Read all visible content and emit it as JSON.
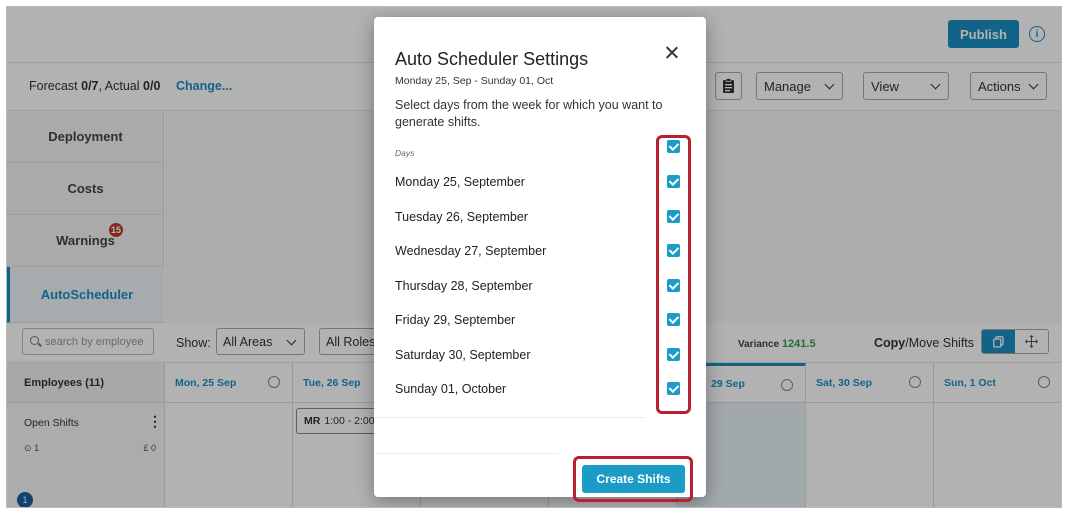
{
  "header": {
    "publish_label": "Publish"
  },
  "subbar": {
    "forecast_label": "Forecast",
    "forecast_value": "0/7",
    "actual_label": "Actual",
    "actual_value": "0/0",
    "change_link": "Change...",
    "manage_label": "Manage",
    "view_label": "View",
    "actions_label": "Actions"
  },
  "sidebar": {
    "items": [
      {
        "label": "Deployment"
      },
      {
        "label": "Costs"
      },
      {
        "label": "Warnings",
        "badge": "15"
      },
      {
        "label": "AutoScheduler"
      }
    ]
  },
  "filters": {
    "search_placeholder": "search by employee",
    "show_label": "Show:",
    "areas_value": "All Areas",
    "roles_value": "All Roles",
    "variance_label": "Variance",
    "variance_value": "1241.5",
    "copy_label": "Copy",
    "move_label": "/Move Shifts"
  },
  "calendar": {
    "employees_header": "Employees (11)",
    "days": [
      "Mon, 25 Sep",
      "Tue, 26 Sep",
      "29 Sep",
      "Sat, 30 Sep",
      "Sun, 1 Oct"
    ],
    "open_shifts_label": "Open Shifts",
    "open_shifts_count": "1",
    "open_shifts_cost": "£ 0",
    "shift_chip_role": "MR",
    "shift_chip_time": "1:00 - 2:00"
  },
  "modal": {
    "title": "Auto Scheduler Settings",
    "date_range": "Monday 25, Sep - Sunday 01, Oct",
    "description": "Select days from the week for which you want to generate shifts.",
    "days_label": "Days",
    "days": [
      {
        "label": "Monday 25, September",
        "checked": true
      },
      {
        "label": "Tuesday 26, September",
        "checked": true
      },
      {
        "label": "Wednesday 27, September",
        "checked": true
      },
      {
        "label": "Thursday 28, September",
        "checked": true
      },
      {
        "label": "Friday 29, September",
        "checked": true
      },
      {
        "label": "Saturday 30, September",
        "checked": true
      },
      {
        "label": "Sunday 01, October",
        "checked": true
      }
    ],
    "select_all_checked": true,
    "create_button": "Create Shifts"
  },
  "footer": {
    "notification_count": "1"
  },
  "colors": {
    "accent": "#1a8fc2",
    "highlight": "#b7212f",
    "variance": "#2e9e4f",
    "badge": "#c0392b"
  }
}
